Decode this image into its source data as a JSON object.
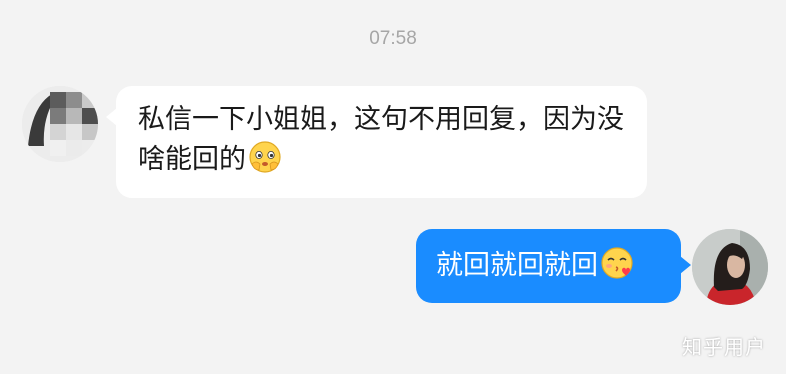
{
  "chat": {
    "timestamp": "07:58",
    "messages": [
      {
        "direction": "incoming",
        "text": "私信一下小姐姐，这句不用回复，因为没啥能回的",
        "emoji": "shy-smile-emoji"
      },
      {
        "direction": "outgoing",
        "text": "就回就回就回",
        "emoji": "kiss-heart-emoji"
      }
    ]
  },
  "watermark": "知乎用户",
  "colors": {
    "background": "#f3f3f3",
    "incoming_bubble": "#ffffff",
    "outgoing_bubble": "#1a8cff",
    "timestamp_text": "#a6a6a6"
  }
}
